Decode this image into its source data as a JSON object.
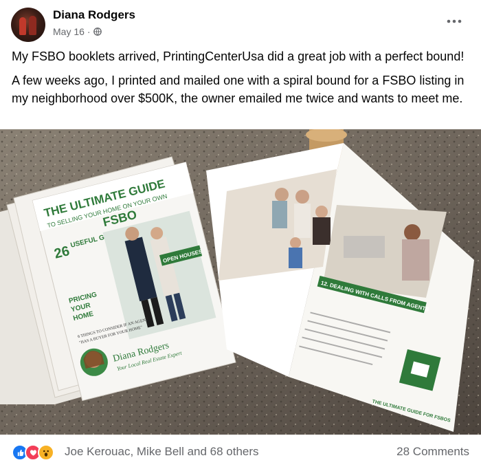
{
  "post": {
    "author": "Diana Rodgers",
    "date": "May 16",
    "separator": "·",
    "privacy_icon": "globe-icon",
    "more_icon": "more-options-icon",
    "paragraphs": [
      "My FSBO booklets arrived, PrintingCenterUsa did a great job with a perfect bound!",
      "A few weeks ago, I printed and mailed one with a spiral bound for a FSBO listing in my neighborhood over $500K, the owner emailed me twice and wants to meet me."
    ]
  },
  "photo": {
    "booklet_title_line1": "THE ULTIMATE GUIDE",
    "booklet_title_line2": "TO SELLING YOUR HOME ON YOUR OWN",
    "booklet_title_line3": "FSBO",
    "booklet_count": "26",
    "booklet_useful": "USEFUL GUIDES",
    "booklet_open_houses": "OPEN HOUSES",
    "booklet_pricing_1": "PRICING",
    "booklet_pricing_2": "YOUR",
    "booklet_pricing_3": "HOME",
    "booklet_things_1": "6 THINGS TO CONSIDER IF AN AGENT",
    "booklet_things_2": "\"HAS A BUYER FOR YOUR HOME\"",
    "booklet_author": "Diana Rodgers",
    "booklet_author_sub": "Your Local Real Estate Expert",
    "page_heading": "12. DEALING WITH CALLS FROM AGENTS",
    "page_footer": "THE ULTIMATE GUIDE FOR FSBOS"
  },
  "footer": {
    "reaction_icons": [
      "like-icon",
      "love-icon",
      "wow-icon"
    ],
    "reactors": "Joe Kerouac, Mike Bell and 68 others",
    "comments": "28 Comments"
  },
  "colors": {
    "like": "#1877f2",
    "love": "#f33e58",
    "wow": "#f7b125",
    "secondary_text": "#65676b",
    "booklet_green": "#2f7a3a"
  }
}
